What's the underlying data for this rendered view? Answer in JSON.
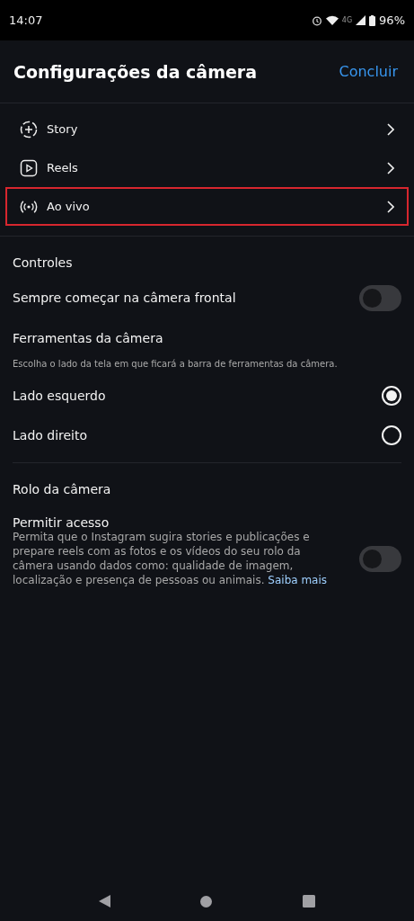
{
  "status_bar": {
    "time": "14:07",
    "network": "4G",
    "battery": "96%"
  },
  "header": {
    "title": "Configurações da câmera",
    "action": "Concluir"
  },
  "formats": [
    {
      "kind": "story",
      "label": "Story",
      "highlighted": false
    },
    {
      "kind": "reels",
      "label": "Reels",
      "highlighted": false
    },
    {
      "kind": "live",
      "label": "Ao vivo",
      "highlighted": true
    }
  ],
  "controls": {
    "heading": "Controles",
    "toggle": {
      "label": "Sempre começar na câmera frontal",
      "on": false
    }
  },
  "camera_tools": {
    "heading": "Ferramentas da câmera",
    "description": "Escolha o lado da tela em que ficará a barra de ferramentas da câmera.",
    "options": [
      {
        "label": "Lado esquerdo",
        "selected": true
      },
      {
        "label": "Lado direito",
        "selected": false
      }
    ]
  },
  "camera_roll": {
    "heading": "Rolo da câmera",
    "toggle": {
      "label": "Permitir acesso",
      "description": "Permita que o Instagram sugira stories e publicações e prepare reels com as fotos e os vídeos do seu rolo da câmera usando dados como: qualidade de imagem, localização e presença de pessoas ou animais.",
      "link": "Saiba mais",
      "on": false
    }
  }
}
